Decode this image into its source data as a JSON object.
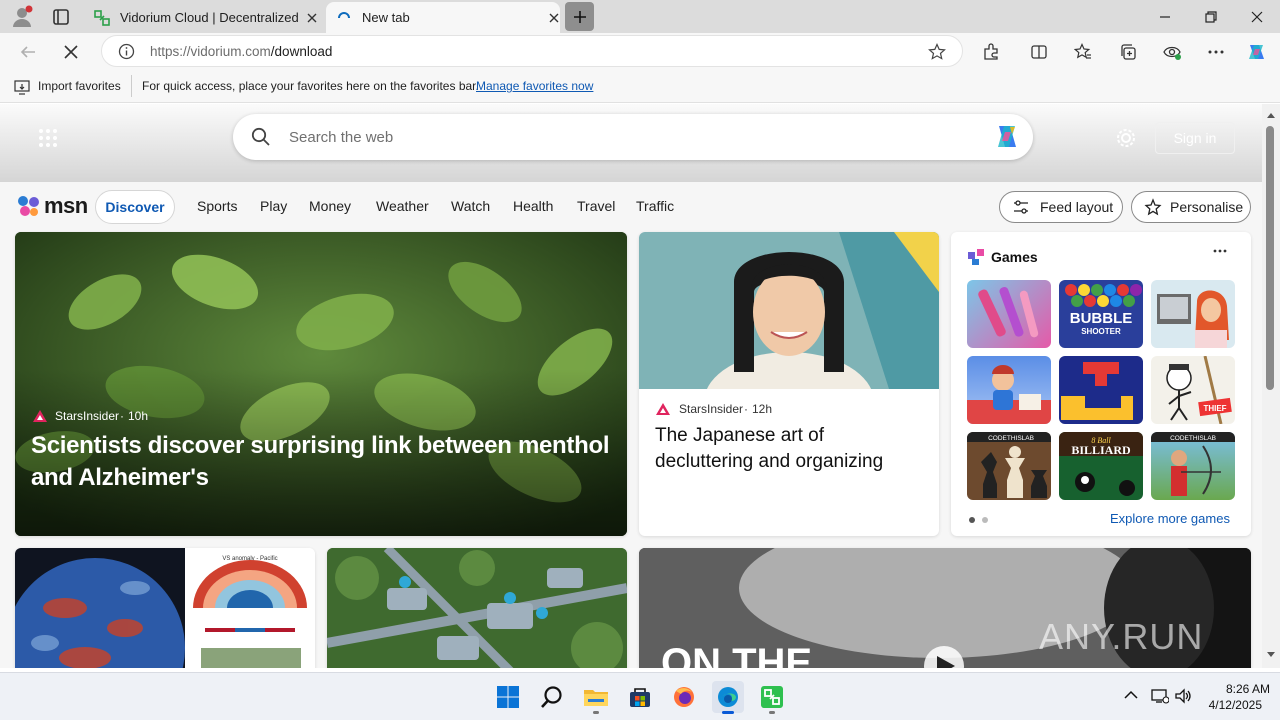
{
  "browser": {
    "tabs": [
      {
        "title": "Vidorium Cloud | Decentralized L"
      },
      {
        "title": "New tab"
      }
    ],
    "address": {
      "scheme_host": "https://vidorium.com",
      "path": "/download"
    },
    "favorites_bar": {
      "import_label": "Import favorites",
      "hint": "For quick access, place your favorites here on the favorites bar.",
      "manage_link": "Manage favorites now"
    }
  },
  "msn": {
    "search_placeholder": "Search the web",
    "sign_in": "Sign in",
    "logo_text": "msn",
    "nav": [
      "Discover",
      "Sports",
      "Play",
      "Money",
      "Weather",
      "Watch",
      "Health",
      "Travel",
      "Traffic"
    ],
    "feed_layout": "Feed layout",
    "personalise": "Personalise",
    "hero_story": {
      "source": "StarsInsider",
      "age": "10h",
      "headline": "Scientists discover surprising link between menthol and Alzheimer's"
    },
    "side_story": {
      "source": "StarsInsider",
      "age": "12h",
      "headline": "The Japanese art of decluttering and organizing"
    },
    "games": {
      "title": "Games",
      "more_label": "Explore more games",
      "tiles": [
        "makeup",
        "bubble-shooter",
        "doctor",
        "cartoon-builder",
        "block-puzzle",
        "stickman-thief",
        "chess",
        "8-ball-billiard",
        "archery"
      ],
      "tile_captions": {
        "bubble": "BUBBLE",
        "shooter": "SHOOTER",
        "billiard": "BILLIARD",
        "ball8": "8 Ball",
        "codethislab": "CODETHISLAB",
        "thief": "THIEF"
      }
    },
    "bottom_cards": {
      "chart_title": "VS anomaly - Pacific",
      "video_text": "ON THE",
      "watermark": "ANY.RUN"
    }
  },
  "taskbar": {
    "time": "8:26 AM",
    "date": "4/12/2025",
    "apps": [
      "windows-start",
      "search",
      "file-explorer",
      "store",
      "firefox",
      "edge",
      "vidorium-app"
    ]
  }
}
